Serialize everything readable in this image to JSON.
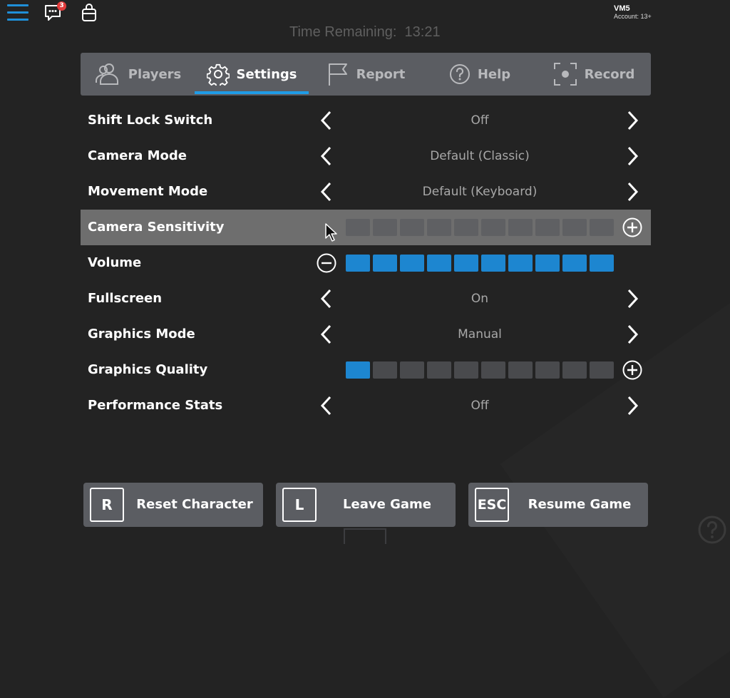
{
  "topbar": {
    "chat_badge": "3",
    "account_name": "VM5",
    "account_age": "Account: 13+"
  },
  "timer": "Time Remaining:  13:21",
  "tabs": [
    {
      "label": "Players",
      "icon": "players-icon"
    },
    {
      "label": "Settings",
      "icon": "gear-icon",
      "active": true
    },
    {
      "label": "Report",
      "icon": "flag-icon"
    },
    {
      "label": "Help",
      "icon": "help-icon"
    },
    {
      "label": "Record",
      "icon": "record-icon"
    }
  ],
  "settings": [
    {
      "label": "Shift Lock Switch",
      "type": "select",
      "value": "Off"
    },
    {
      "label": "Camera Mode",
      "type": "select",
      "value": "Default (Classic)"
    },
    {
      "label": "Movement Mode",
      "type": "select",
      "value": "Default (Keyboard)"
    },
    {
      "label": "Camera Sensitivity",
      "type": "slider",
      "level": 0,
      "max": 10
    },
    {
      "label": "Volume",
      "type": "slider",
      "level": 10,
      "max": 10
    },
    {
      "label": "Fullscreen",
      "type": "select",
      "value": "On"
    },
    {
      "label": "Graphics Mode",
      "type": "select",
      "value": "Manual"
    },
    {
      "label": "Graphics Quality",
      "type": "slider",
      "level": 1,
      "max": 10
    },
    {
      "label": "Performance Stats",
      "type": "select",
      "value": "Off"
    }
  ],
  "buttons": [
    {
      "key": "R",
      "label": "Reset Character"
    },
    {
      "key": "L",
      "label": "Leave Game"
    },
    {
      "key": "ESC",
      "label": "Resume Game"
    }
  ],
  "colors": {
    "accent": "#1f9ce6",
    "slider_on": "#1d86d0",
    "slider_off": "#494a4d",
    "panel": "#5b5d62",
    "background": "#232323"
  }
}
